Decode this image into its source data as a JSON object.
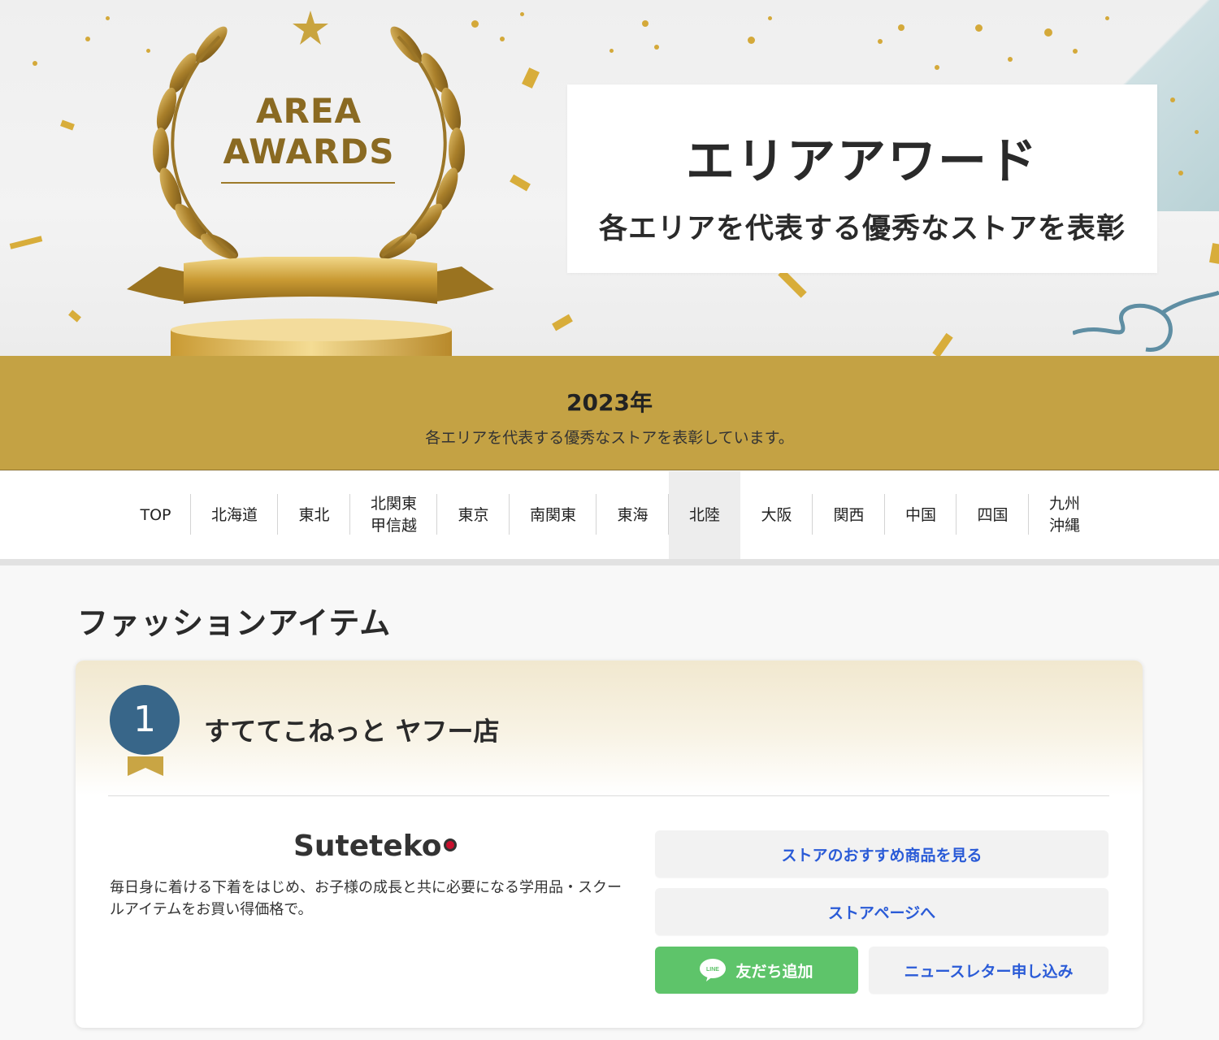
{
  "hero": {
    "award_line1": "AREA",
    "award_line2": "AWARDS",
    "title": "エリアアワード",
    "subtitle": "各エリアを代表する優秀なストアを表彰"
  },
  "band": {
    "year": "2023年",
    "description": "各エリアを代表する優秀なストアを表彰しています。"
  },
  "nav": {
    "items": [
      {
        "line1": "TOP",
        "line2": ""
      },
      {
        "line1": "北海道",
        "line2": ""
      },
      {
        "line1": "東北",
        "line2": ""
      },
      {
        "line1": "北関東",
        "line2": "甲信越"
      },
      {
        "line1": "東京",
        "line2": ""
      },
      {
        "line1": "南関東",
        "line2": ""
      },
      {
        "line1": "東海",
        "line2": ""
      },
      {
        "line1": "北陸",
        "line2": ""
      },
      {
        "line1": "大阪",
        "line2": ""
      },
      {
        "line1": "関西",
        "line2": ""
      },
      {
        "line1": "中国",
        "line2": ""
      },
      {
        "line1": "四国",
        "line2": ""
      },
      {
        "line1": "九州",
        "line2": "沖縄"
      }
    ],
    "active": "北陸"
  },
  "section": {
    "title": "ファッションアイテム"
  },
  "store": {
    "rank": "1",
    "name": "すててこねっと ヤフー店",
    "logo_text": "Suteteko",
    "description": "毎日身に着ける下着をはじめ、お子様の成長と共に必要になる学用品・スクールアイテムをお買い得価格で。",
    "buttons": {
      "recommend": "ストアのおすすめ商品を見る",
      "store_page": "ストアページへ",
      "line_icon_text": "LINE",
      "line_add": "友だち追加",
      "newsletter": "ニュースレター申し込み"
    }
  },
  "colors": {
    "gold_band": "#c4a244",
    "rank_badge": "#386689",
    "link_blue": "#2a5bd7",
    "line_green": "#5ec46a"
  }
}
